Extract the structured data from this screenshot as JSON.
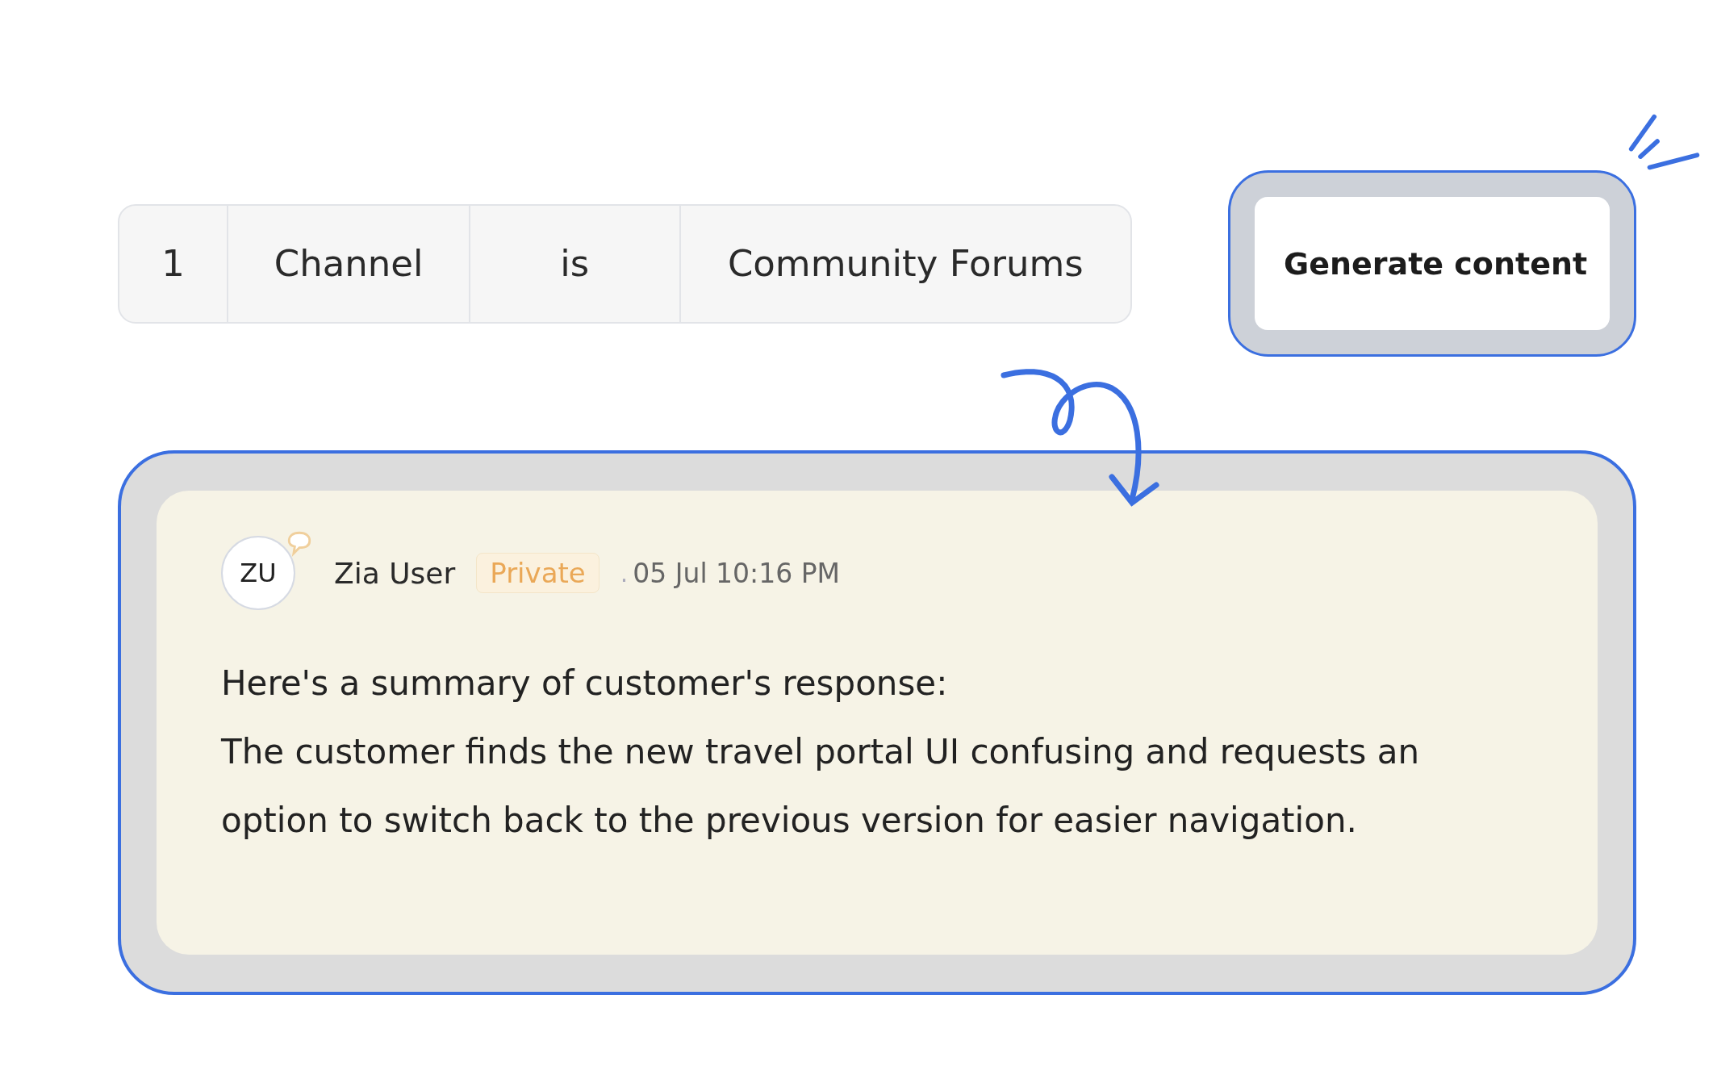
{
  "condition": {
    "cells": [
      "1",
      "Channel",
      "is",
      "Community Forums"
    ]
  },
  "generate_button": {
    "label": "Generate content"
  },
  "note": {
    "avatar_initials": "ZU",
    "author": "Zia User",
    "badge": "Private",
    "separator": ".",
    "time": "05 Jul 10:16 PM",
    "heading": "Here's a summary of customer's response:",
    "body": "The customer finds the new travel portal UI confusing and requests an option to switch back to the previous version for easier navigation."
  }
}
